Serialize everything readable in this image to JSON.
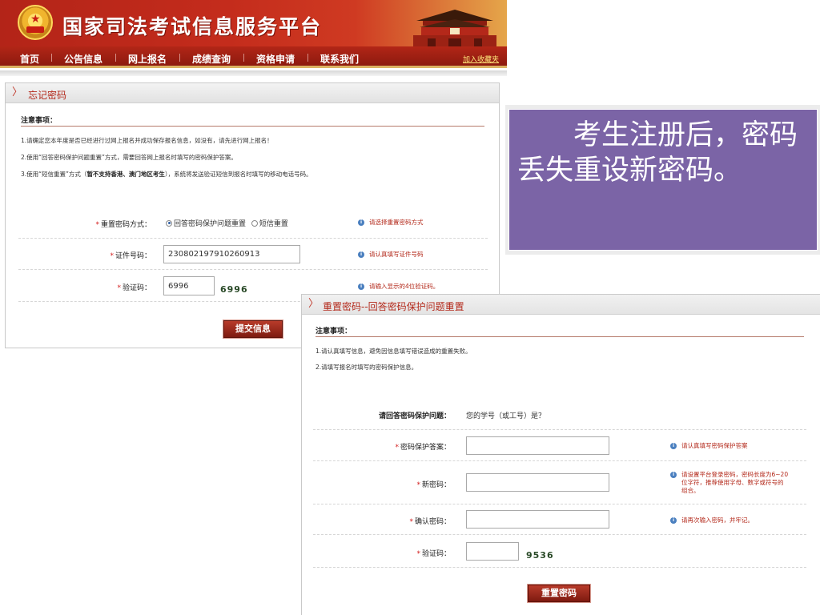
{
  "site": {
    "title": "国家司法考试信息服务平台",
    "nav": [
      "首页",
      "公告信息",
      "网上报名",
      "成绩查询",
      "资格申请",
      "联系我们"
    ],
    "bookmark": "加入收藏夹"
  },
  "forgot_panel": {
    "title": "忘记密码",
    "notes_heading": "注意事项：",
    "notes": [
      "1.请确定您本年度是否已经进行过网上报名并成功保存报名信息，如没有，请先进行网上报名！",
      "2.使用“回答密码保护问题重置”方式，需要回答网上报名时填写的密码保护答案。",
      "3.使用“短信重置”方式（",
      "暂不支持香港、澳门地区考生",
      "），系统将发送验证短信到报名时填写的移动电话号码。"
    ],
    "method_label": "重置密码方式：",
    "method_options": [
      "回答密码保护问题重置",
      "短信重置"
    ],
    "method_hint": "请选择重置密码方式",
    "id_label": "证件号码：",
    "id_value": "230802197910260913",
    "id_hint": "请认真填写证件号码",
    "captcha_label": "验证码：",
    "captcha_value": "6996",
    "captcha_image": "6996",
    "captcha_hint": "请输入显示的4位验证码。",
    "submit_label": "提交信息"
  },
  "reset_panel": {
    "title": "重置密码--回答密码保护问题重置",
    "notes_heading": "注意事项：",
    "notes": [
      "1.请认真填写信息，避免因信息填写错误造成的重置失败。",
      "2.请填写报名时填写的密码保护信息。"
    ],
    "question_label": "请回答密码保护问题：",
    "question_value": "您的学号（或工号）是？",
    "answer_label": "密码保护答案：",
    "answer_hint": "请认真填写密码保护答案",
    "new_password_label": "新密码：",
    "new_password_hint": [
      "请设置平台登录密码，密码长度为6~20",
      "位字符，推荐使用字母、数字或符号的",
      "组合。"
    ],
    "confirm_label": "确认密码：",
    "confirm_hint": "请再次输入密码，并牢记。",
    "captcha_label": "验证码：",
    "captcha_image": "9536",
    "submit_label": "重置密码"
  },
  "callout": {
    "text": "考生注册后，密码丢失重设新密码。"
  },
  "colors": {
    "brand_red": "#b32418",
    "callout_purple": "#7b64a6",
    "hint_red": "#b3281a"
  }
}
